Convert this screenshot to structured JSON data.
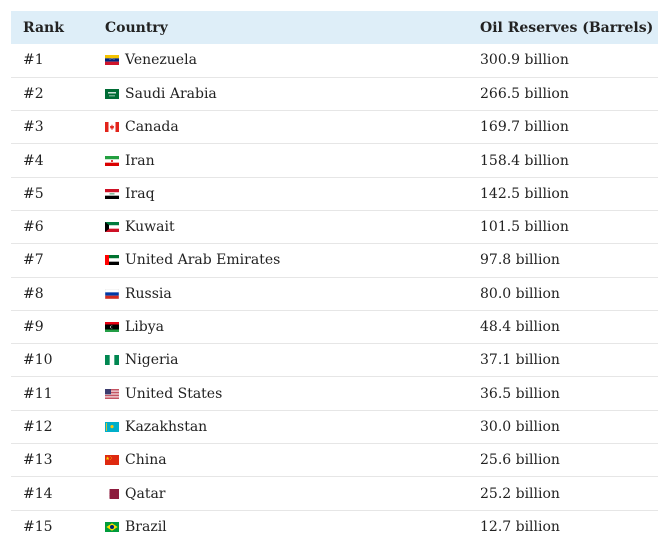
{
  "table": {
    "headers": {
      "rank": "Rank",
      "country": "Country",
      "oil": "Oil Reserves (Barrels)"
    },
    "rows": [
      {
        "rank": "#1",
        "country": "Venezuela",
        "flag": "venezuela-flag-icon",
        "oil": "300.9 billion"
      },
      {
        "rank": "#2",
        "country": "Saudi Arabia",
        "flag": "saudi-arabia-flag-icon",
        "oil": "266.5 billion"
      },
      {
        "rank": "#3",
        "country": "Canada",
        "flag": "canada-flag-icon",
        "oil": "169.7 billion"
      },
      {
        "rank": "#4",
        "country": "Iran",
        "flag": "iran-flag-icon",
        "oil": "158.4 billion"
      },
      {
        "rank": "#5",
        "country": "Iraq",
        "flag": "iraq-flag-icon",
        "oil": "142.5 billion"
      },
      {
        "rank": "#6",
        "country": "Kuwait",
        "flag": "kuwait-flag-icon",
        "oil": "101.5 billion"
      },
      {
        "rank": "#7",
        "country": "United Arab Emirates",
        "flag": "uae-flag-icon",
        "oil": "97.8 billion"
      },
      {
        "rank": "#8",
        "country": "Russia",
        "flag": "russia-flag-icon",
        "oil": "80.0 billion"
      },
      {
        "rank": "#9",
        "country": "Libya",
        "flag": "libya-flag-icon",
        "oil": "48.4 billion"
      },
      {
        "rank": "#10",
        "country": "Nigeria",
        "flag": "nigeria-flag-icon",
        "oil": "37.1 billion"
      },
      {
        "rank": "#11",
        "country": "United States",
        "flag": "united-states-flag-icon",
        "oil": "36.5 billion"
      },
      {
        "rank": "#12",
        "country": "Kazakhstan",
        "flag": "kazakhstan-flag-icon",
        "oil": "30.0 billion"
      },
      {
        "rank": "#13",
        "country": "China",
        "flag": "china-flag-icon",
        "oil": "25.6 billion"
      },
      {
        "rank": "#14",
        "country": "Qatar",
        "flag": "qatar-flag-icon",
        "oil": "25.2 billion"
      },
      {
        "rank": "#15",
        "country": "Brazil",
        "flag": "brazil-flag-icon",
        "oil": "12.7 billion"
      }
    ]
  },
  "colors": {
    "header_bg": "#deeef8",
    "row_divider": "#e6e6e6",
    "text": "#222222"
  }
}
